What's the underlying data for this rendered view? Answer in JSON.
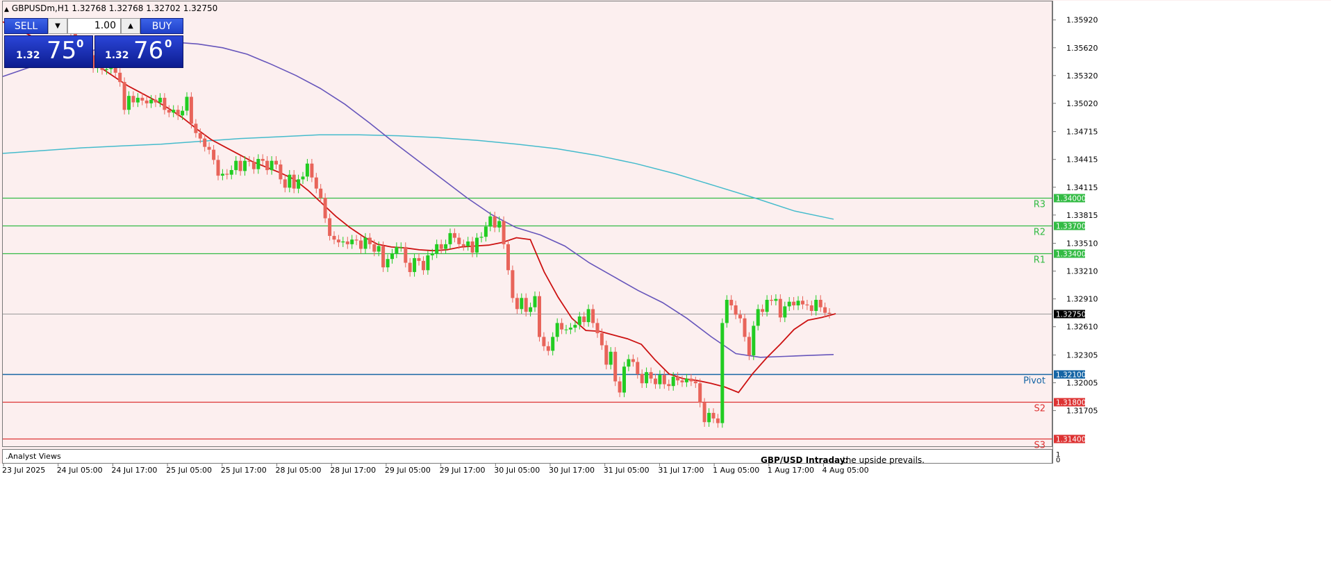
{
  "symbol_info": {
    "symbol": "GBPUSDm,H1",
    "open": "1.32768",
    "high": "1.32768",
    "low": "1.32702",
    "close": "1.32750"
  },
  "trade_panel": {
    "sell_label": "SELL",
    "buy_label": "BUY",
    "lot_value": "1.00",
    "sell_prefix": "1.32",
    "sell_big": "75",
    "sell_sup": "0",
    "buy_prefix": "1.32",
    "buy_big": "76",
    "buy_sup": "0"
  },
  "subwindow": {
    "label": ".Analyst Views",
    "scale_top": "1",
    "scale_bottom": "0",
    "overlay_title": "GBP/USD Intraday:",
    "overlay_text": "the upside prevails."
  },
  "colors": {
    "chart_bg": "#fcefef",
    "bull": "#22cc22",
    "bear": "#e8645a",
    "ma_fast": "#cc1111",
    "ma_mid": "#6655bb",
    "ma_slow": "#44bbcc",
    "resistance": "#33bb44",
    "pivot": "#1565a5",
    "support": "#dd3333",
    "current_price": "#999999"
  },
  "chart_data": {
    "type": "candlestick",
    "symbol": "GBPUSDm",
    "timeframe": "H1",
    "ylim": [
      1.3132,
      1.3612
    ],
    "yticks": [
      "1.35920",
      "1.35620",
      "1.35320",
      "1.35020",
      "1.34715",
      "1.34415",
      "1.34115",
      "1.33815",
      "1.33510",
      "1.33210",
      "1.32910",
      "1.32610",
      "1.32305",
      "1.32005",
      "1.31705"
    ],
    "xticks": [
      "23 Jul 2025",
      "24 Jul 05:00",
      "24 Jul 17:00",
      "25 Jul 05:00",
      "25 Jul 17:00",
      "28 Jul 05:00",
      "28 Jul 17:00",
      "29 Jul 05:00",
      "29 Jul 17:00",
      "30 Jul 05:00",
      "30 Jul 17:00",
      "31 Jul 05:00",
      "31 Jul 17:00",
      "1 Aug 05:00",
      "1 Aug 17:00",
      "4 Aug 05:00"
    ],
    "current_price": "1.32750",
    "levels": [
      {
        "name": "R3",
        "label": "1.34000",
        "value": 1.34,
        "kind": "resistance"
      },
      {
        "name": "R2",
        "label": "1.33700",
        "value": 1.337,
        "kind": "resistance"
      },
      {
        "name": "R1",
        "label": "1.33400",
        "value": 1.334,
        "kind": "resistance"
      },
      {
        "name": "Pivot",
        "label": "1.32100",
        "value": 1.321,
        "kind": "pivot"
      },
      {
        "name": "S2",
        "label": "1.31800",
        "value": 1.318,
        "kind": "support"
      },
      {
        "name": "S3",
        "label": "1.31400",
        "value": 1.314,
        "kind": "support"
      }
    ],
    "closes": [
      1.3578,
      1.357,
      1.3563,
      1.3553,
      1.3554,
      1.354,
      1.3547,
      1.3538,
      1.3539,
      1.355,
      1.3535,
      1.3525,
      1.3495,
      1.351,
      1.3503,
      1.3508,
      1.3505,
      1.3502,
      1.3506,
      1.3503,
      1.3508,
      1.3495,
      1.3492,
      1.3495,
      1.3489,
      1.3494,
      1.3509,
      1.348,
      1.347,
      1.3464,
      1.3455,
      1.3452,
      1.3441,
      1.3424,
      1.3426,
      1.3425,
      1.343,
      1.344,
      1.3429,
      1.344,
      1.3439,
      1.3431,
      1.3442,
      1.344,
      1.343,
      1.344,
      1.3436,
      1.342,
      1.3411,
      1.3425,
      1.341,
      1.342,
      1.3423,
      1.3437,
      1.3422,
      1.341,
      1.34,
      1.3378,
      1.3359,
      1.3355,
      1.3352,
      1.3353,
      1.335,
      1.3355,
      1.3354,
      1.3345,
      1.3357,
      1.335,
      1.3342,
      1.3348,
      1.3325,
      1.3334,
      1.334,
      1.3347,
      1.3347,
      1.333,
      1.332,
      1.3335,
      1.3332,
      1.3322,
      1.3338,
      1.334,
      1.335,
      1.3345,
      1.335,
      1.3362,
      1.3357,
      1.335,
      1.3348,
      1.3353,
      1.3341,
      1.3357,
      1.3358,
      1.3369,
      1.338,
      1.3368,
      1.3375,
      1.335,
      1.3322,
      1.3292,
      1.328,
      1.3292,
      1.3277,
      1.3282,
      1.3294,
      1.325,
      1.324,
      1.3235,
      1.325,
      1.3265,
      1.3258,
      1.3258,
      1.326,
      1.3263,
      1.3272,
      1.3266,
      1.328,
      1.3265,
      1.3254,
      1.3241,
      1.322,
      1.3234,
      1.3202,
      1.319,
      1.3218,
      1.3226,
      1.3223,
      1.321,
      1.32,
      1.3212,
      1.3205,
      1.3199,
      1.3209,
      1.3199,
      1.3197,
      1.3207,
      1.3203,
      1.3201,
      1.3205,
      1.3202,
      1.32,
      1.3179,
      1.3158,
      1.3168,
      1.3162,
      1.3157,
      1.3265,
      1.329,
      1.3284,
      1.3274,
      1.327,
      1.325,
      1.323,
      1.3262,
      1.328,
      1.3277,
      1.329,
      1.3289,
      1.3291,
      1.3271,
      1.3283,
      1.3288,
      1.3284,
      1.3289,
      1.3285,
      1.3284,
      1.3278,
      1.329,
      1.3282,
      1.3276,
      1.3275
    ],
    "ma_fast": [
      1.359,
      1.3583,
      1.3575,
      1.3568,
      1.3563,
      1.3555,
      1.355,
      1.3541,
      1.3531,
      1.3521,
      1.3513,
      1.3505,
      1.3496,
      1.3486,
      1.3474,
      1.3463,
      1.3455,
      1.3447,
      1.3439,
      1.3433,
      1.3427,
      1.342,
      1.3408,
      1.3394,
      1.338,
      1.3368,
      1.3358,
      1.335,
      1.3347,
      1.3346,
      1.3344,
      1.3343,
      1.3344,
      1.3347,
      1.3348,
      1.3349,
      1.3352,
      1.3357,
      1.3355,
      1.332,
      1.3293,
      1.327,
      1.3257,
      1.3256,
      1.3252,
      1.3248,
      1.3242,
      1.3225,
      1.321,
      1.3205,
      1.3203,
      1.32,
      1.3196,
      1.319,
      1.321,
      1.3227,
      1.3242,
      1.3258,
      1.3268,
      1.3271,
      1.3275
    ],
    "ma_mid": [
      1.3531,
      1.354,
      1.3548,
      1.3555,
      1.3561,
      1.3566,
      1.3568,
      1.3568,
      1.3566,
      1.3562,
      1.3555,
      1.3544,
      1.3532,
      1.3518,
      1.3501,
      1.3481,
      1.346,
      1.344,
      1.342,
      1.34,
      1.3382,
      1.3368,
      1.336,
      1.3348,
      1.333,
      1.3315,
      1.33,
      1.3287,
      1.327,
      1.325,
      1.3232,
      1.3228,
      1.3229,
      1.323,
      1.3231
    ],
    "ma_slow": [
      1.3448,
      1.3451,
      1.3454,
      1.3456,
      1.3458,
      1.3461,
      1.3464,
      1.3466,
      1.3468,
      1.3468,
      1.3467,
      1.3465,
      1.3462,
      1.3458,
      1.3453,
      1.3446,
      1.3437,
      1.3426,
      1.3413,
      1.34,
      1.3386,
      1.3377
    ]
  }
}
